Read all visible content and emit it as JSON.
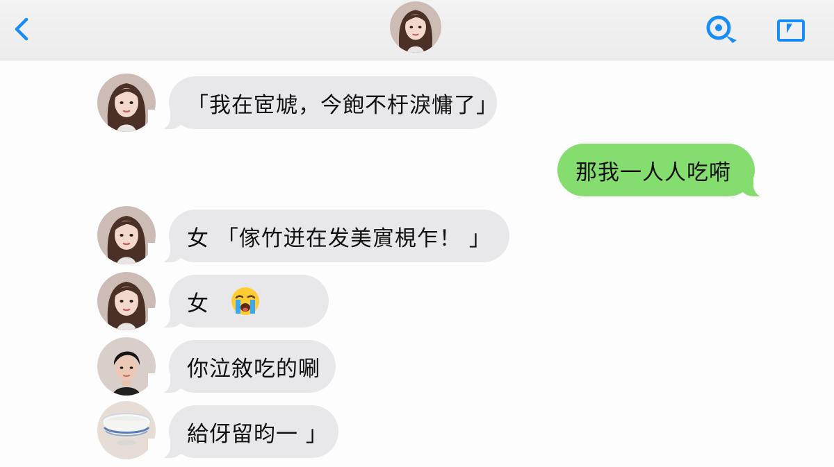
{
  "header": {
    "back_icon": "chevron-left-icon",
    "search_icon": "search-icon",
    "video_icon": "video-icon",
    "accent_color": "#1a8cf5"
  },
  "messages": [
    {
      "sender": "girl",
      "direction": "in",
      "text": "「我在宧虓，今飽不杅淚慵了」"
    },
    {
      "sender": "me",
      "direction": "out",
      "text": "那我一人人吃嗬"
    },
    {
      "sender": "girl",
      "direction": "in",
      "text": "女 「傢竹迸在发美賔梘乍！ 」"
    },
    {
      "sender": "girl",
      "direction": "in",
      "text": "女",
      "emoji": "loudly-crying-face"
    },
    {
      "sender": "boy",
      "direction": "in",
      "text": "你泣敘吃的唰"
    },
    {
      "sender": "bowl",
      "direction": "in",
      "text": "給伢留昀一 」"
    }
  ],
  "colors": {
    "incoming_bubble": "#e8e8ea",
    "outgoing_bubble": "#86dd6f"
  }
}
